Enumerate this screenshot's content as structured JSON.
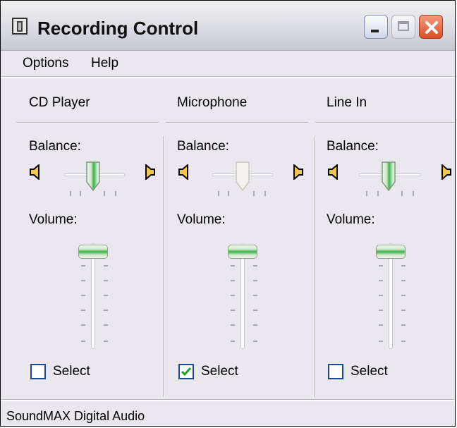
{
  "window": {
    "title": "Recording Control",
    "icon": "mixer-app-icon"
  },
  "menu": {
    "items": [
      "Options",
      "Help"
    ]
  },
  "channels": [
    {
      "name": "CD Player",
      "balance_label": "Balance:",
      "volume_label": "Volume:",
      "select_label": "Select",
      "selected": false,
      "balance": 0.5,
      "volume": 1.0,
      "enabled": true
    },
    {
      "name": "Microphone",
      "balance_label": "Balance:",
      "volume_label": "Volume:",
      "select_label": "Select",
      "selected": true,
      "balance": 0.5,
      "volume": 1.0,
      "enabled": false
    },
    {
      "name": "Line In",
      "balance_label": "Balance:",
      "volume_label": "Volume:",
      "select_label": "Select",
      "selected": false,
      "balance": 0.5,
      "volume": 1.0,
      "enabled": true
    }
  ],
  "status": {
    "text": "SoundMAX Digital Audio"
  },
  "colors": {
    "thumb_green": "#39b24a",
    "checkbox_border": "#1c4a8c",
    "close_red": "#d94f28"
  }
}
